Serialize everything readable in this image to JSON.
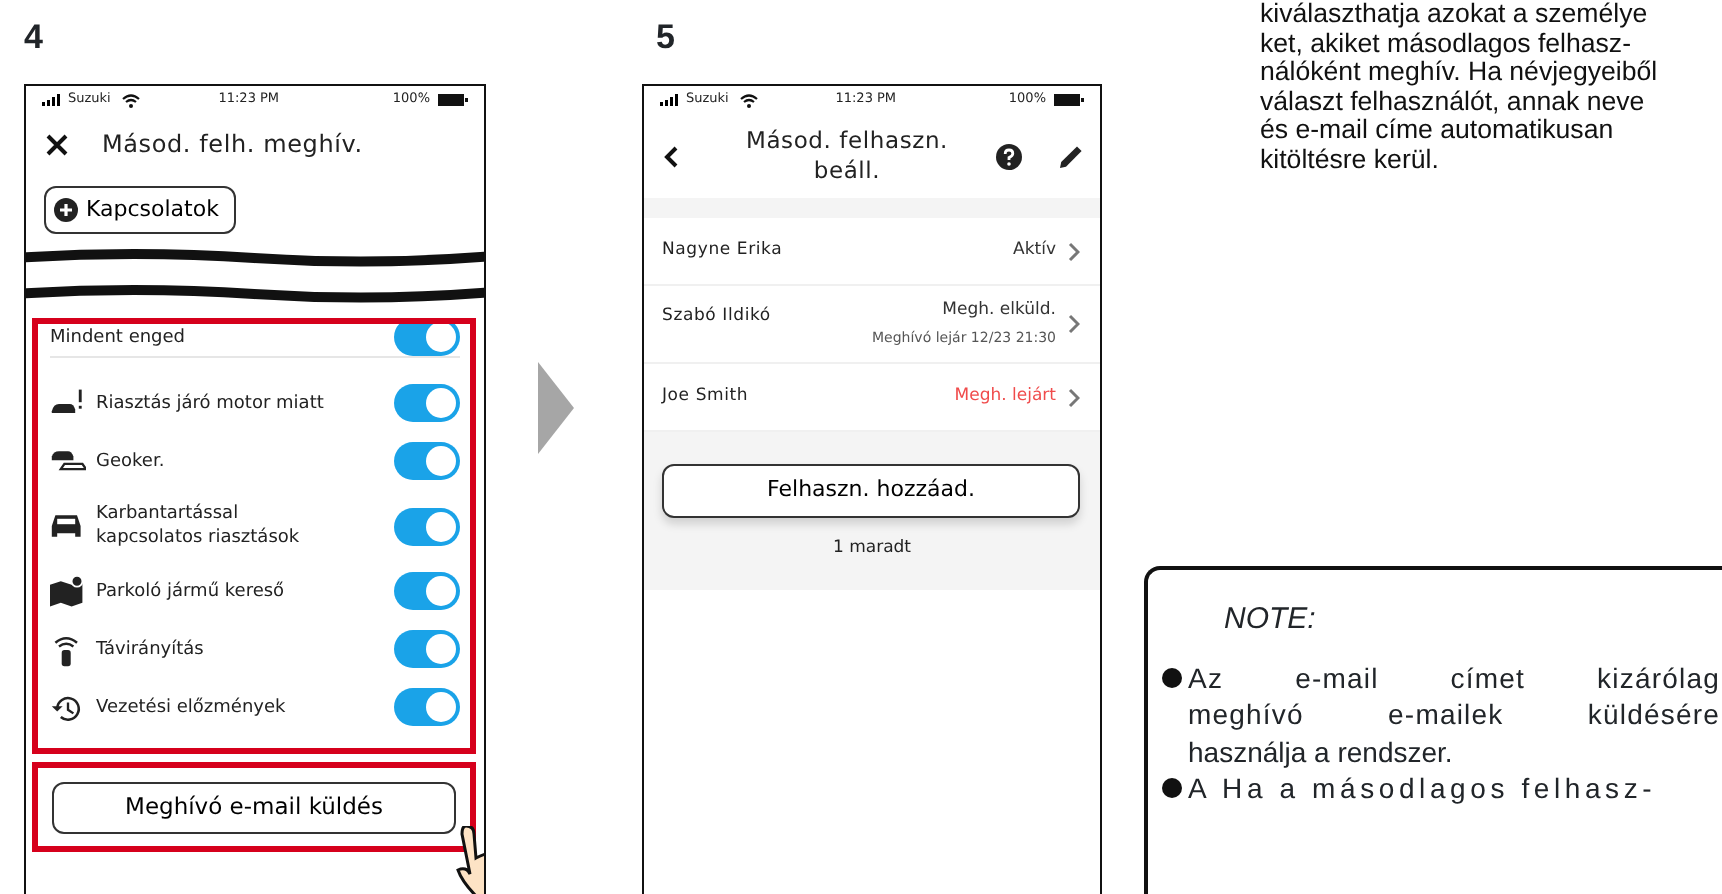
{
  "step_4": {
    "number": "4",
    "status_bar": {
      "carrier": "Suzuki",
      "time": "11:23 PM",
      "battery": "100%"
    },
    "title": "Másod. felh. meghív.",
    "contacts_button": "Kapcsolatok",
    "permissions": [
      {
        "kind": "all",
        "label": "Mindent enged",
        "on": true
      },
      {
        "kind": "car-alert",
        "label": "Riasztás járó motor miatt",
        "on": true
      },
      {
        "kind": "geofence",
        "label": "Geoker.",
        "on": true
      },
      {
        "kind": "car",
        "label": "Karbantartással kapcsolatos riasztások",
        "on": true
      },
      {
        "kind": "map",
        "label": "Parkoló jármű kereső",
        "on": true
      },
      {
        "kind": "remote",
        "label": "Távirányítás",
        "on": true
      },
      {
        "kind": "history",
        "label": "Vezetési előzmények",
        "on": true
      }
    ],
    "send_button": "Meghívó e-mail küldés"
  },
  "step_5": {
    "number": "5",
    "status_bar": {
      "carrier": "Suzuki",
      "time": "11:23 PM",
      "battery": "100%"
    },
    "title": "Másod. felhaszn. beáll.",
    "users": [
      {
        "name": "Nagyne Erika",
        "status": "Aktív",
        "kind": "active"
      },
      {
        "name": "Szabó Ildikó",
        "status": "Megh. elküld.",
        "detail": "Meghívó lejár 12/23 21:30",
        "kind": "sent"
      },
      {
        "name": "Joe Smith",
        "status": "Megh. lejárt",
        "kind": "expired"
      }
    ],
    "add_button": "Felhaszn. hozzáad.",
    "remaining": "1 maradt"
  },
  "text_lines": [
    "kiválaszthatja azokat a személye",
    "ket, akiket másodlagos felhasz-",
    "nálóként meghív. Ha névjegyeiből",
    "választ felhasználót, annak neve",
    "és e-mail címe automatikusan",
    "kitöltésre kerül."
  ],
  "note": {
    "title": "NOTE:",
    "items": [
      {
        "lines": [
          "Az e-mail címet kizárólag",
          "meghívó e-mailek küldésére",
          "használja a rendszer."
        ]
      },
      {
        "lines": [
          "A Ha a másodlagos felhasz-"
        ]
      }
    ]
  }
}
